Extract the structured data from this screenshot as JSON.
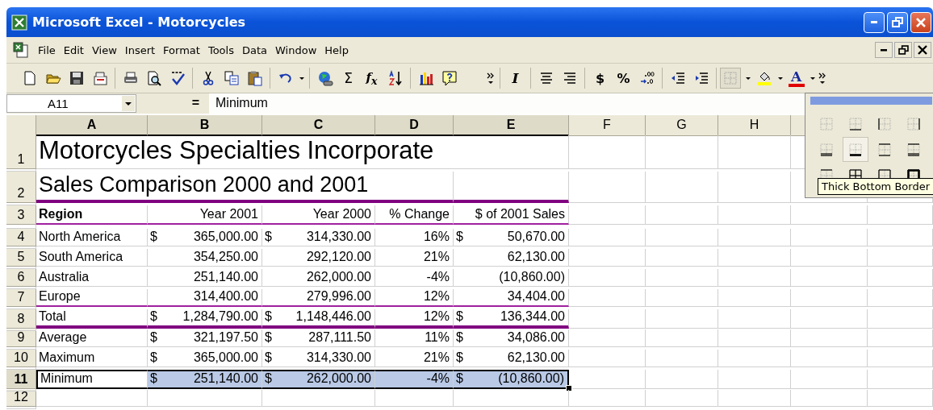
{
  "window": {
    "title": "Microsoft Excel - Motorcycles"
  },
  "menu": [
    "File",
    "Edit",
    "View",
    "Insert",
    "Format",
    "Tools",
    "Data",
    "Window",
    "Help"
  ],
  "toolbar": {
    "sum": "Σ",
    "function": "f$_{x}$",
    "italic": "I",
    "currency": "$",
    "percent": "%",
    "font_color": "A"
  },
  "formula_bar": {
    "name_box": "A11",
    "equals": "=",
    "value": "Minimum"
  },
  "columns": [
    {
      "label": "A",
      "selected": true
    },
    {
      "label": "B",
      "selected": true
    },
    {
      "label": "C",
      "selected": true
    },
    {
      "label": "D",
      "selected": true
    },
    {
      "label": "E",
      "selected": true
    },
    {
      "label": "F",
      "selected": false
    },
    {
      "label": "G",
      "selected": false
    },
    {
      "label": "H",
      "selected": false
    }
  ],
  "rows": [
    {
      "number": "1",
      "kind": "title",
      "selected": false,
      "rule_below": false,
      "rule_thick": false,
      "cells": [
        {
          "text": "Motorcycles Specialties Incorporate"
        }
      ]
    },
    {
      "number": "2",
      "kind": "subtitle",
      "selected": false,
      "rule_below": true,
      "rule_thick": true,
      "cells": [
        {
          "text": "Sales Comparison 2000 and 2001"
        }
      ]
    },
    {
      "number": "3",
      "kind": "header",
      "selected": false,
      "rule_below": true,
      "rule_thick": false,
      "cells": [
        {
          "text": "Region"
        },
        {
          "text": "Year 2001"
        },
        {
          "text": "Year 2000"
        },
        {
          "text": "% Change"
        },
        {
          "text": "$ of 2001 Sales"
        }
      ]
    },
    {
      "number": "4",
      "kind": "data",
      "selected": false,
      "rule_below": false,
      "rule_thick": false,
      "cells": [
        {
          "text": "North America"
        },
        {
          "currency": "$",
          "text": "365,000.00"
        },
        {
          "currency": "$",
          "text": "314,330.00"
        },
        {
          "text": "16%"
        },
        {
          "currency": "$",
          "text": "50,670.00"
        }
      ]
    },
    {
      "number": "5",
      "kind": "data",
      "selected": false,
      "rule_below": false,
      "rule_thick": false,
      "cells": [
        {
          "text": "South America"
        },
        {
          "text": "354,250.00"
        },
        {
          "text": "292,120.00"
        },
        {
          "text": "21%"
        },
        {
          "text": "62,130.00"
        }
      ]
    },
    {
      "number": "6",
      "kind": "data",
      "selected": false,
      "rule_below": false,
      "rule_thick": false,
      "cells": [
        {
          "text": "Australia"
        },
        {
          "text": "251,140.00"
        },
        {
          "text": "262,000.00"
        },
        {
          "text": "-4%"
        },
        {
          "text": "(10,860.00)"
        }
      ]
    },
    {
      "number": "7",
      "kind": "data",
      "selected": false,
      "rule_below": true,
      "rule_thick": false,
      "cells": [
        {
          "text": "Europe"
        },
        {
          "text": "314,400.00"
        },
        {
          "text": "279,996.00"
        },
        {
          "text": "12%"
        },
        {
          "text": "34,404.00"
        }
      ]
    },
    {
      "number": "8",
      "kind": "data",
      "selected": false,
      "rule_below": true,
      "rule_thick": true,
      "cells": [
        {
          "text": "Total"
        },
        {
          "currency": "$",
          "text": "1,284,790.00"
        },
        {
          "currency": "$",
          "text": "1,148,446.00"
        },
        {
          "text": "12%"
        },
        {
          "currency": "$",
          "text": "136,344.00"
        }
      ]
    },
    {
      "number": "9",
      "kind": "data",
      "selected": false,
      "rule_below": false,
      "rule_thick": false,
      "cells": [
        {
          "text": "Average"
        },
        {
          "currency": "$",
          "text": "321,197.50"
        },
        {
          "currency": "$",
          "text": "287,111.50"
        },
        {
          "text": "11%"
        },
        {
          "currency": "$",
          "text": "34,086.00"
        }
      ]
    },
    {
      "number": "10",
      "kind": "data",
      "selected": false,
      "rule_below": false,
      "rule_thick": false,
      "cells": [
        {
          "text": "Maximum"
        },
        {
          "currency": "$",
          "text": "365,000.00"
        },
        {
          "currency": "$",
          "text": "314,330.00"
        },
        {
          "text": "21%"
        },
        {
          "currency": "$",
          "text": "62,130.00"
        }
      ]
    },
    {
      "number": "11",
      "kind": "data",
      "selected": true,
      "rule_below": false,
      "rule_thick": false,
      "cells": [
        {
          "text": "Minimum"
        },
        {
          "currency": "$",
          "text": "251,140.00"
        },
        {
          "currency": "$",
          "text": "262,000.00"
        },
        {
          "text": "-4%"
        },
        {
          "currency": "$",
          "text": "(10,860.00)"
        }
      ]
    },
    {
      "number": "12",
      "kind": "empty",
      "selected": false,
      "rule_below": false,
      "rule_thick": false,
      "cells": []
    }
  ],
  "border_palette": {
    "options": [
      {
        "kind": "none",
        "selected": false
      },
      {
        "kind": "bottom",
        "selected": false
      },
      {
        "kind": "left",
        "selected": false
      },
      {
        "kind": "right",
        "selected": false
      },
      {
        "kind": "double-bottom",
        "selected": false
      },
      {
        "kind": "thick-bottom",
        "selected": true
      },
      {
        "kind": "top-bottom",
        "selected": false
      },
      {
        "kind": "top-double-bottom",
        "selected": false
      },
      {
        "kind": "top-thick-bottom",
        "selected": false
      },
      {
        "kind": "all",
        "selected": false
      },
      {
        "kind": "outside",
        "selected": false
      },
      {
        "kind": "thick-outside",
        "selected": false
      }
    ]
  },
  "tooltip": "Thick Bottom Border"
}
